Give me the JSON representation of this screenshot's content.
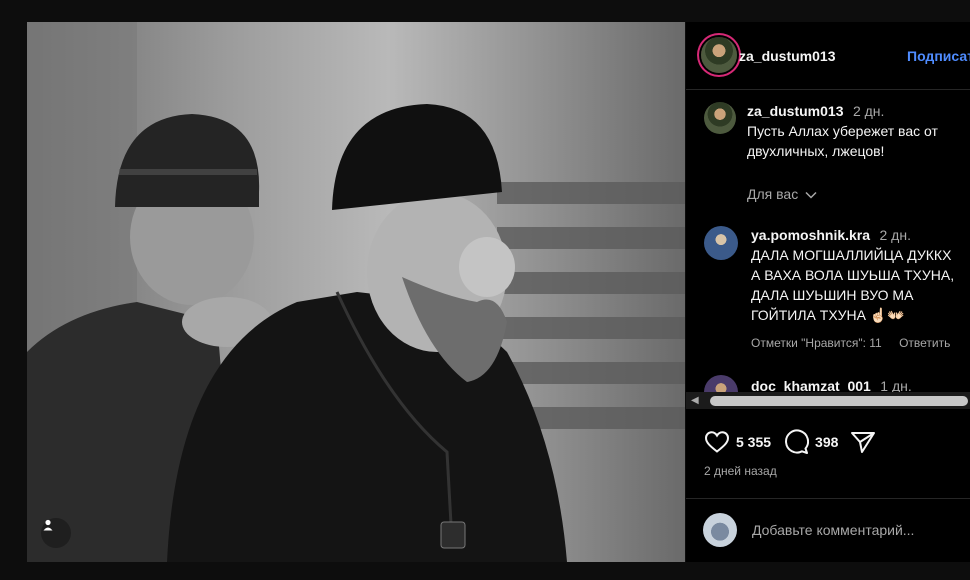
{
  "post": {
    "author": "za_dustum013",
    "follow_label": "Подписаться",
    "likes": "5 355",
    "comments_count": "398",
    "posted_ago": "2 дней назад",
    "add_comment_placeholder": "Добавьте комментарий..."
  },
  "caption": {
    "username": "za_dustum013",
    "time": "2 дн.",
    "text_line1": "Пусть Аллах убережет вас от",
    "text_line2": "двухличных, лжецов!"
  },
  "for_you_label": "Для вас",
  "comments": [
    {
      "username": "ya.pomoshnik.kra",
      "time": "2 дн.",
      "lines": [
        "ДАЛА МОГШАЛЛИЙЦА ДУККХ",
        "А ВАХА ВОЛА ШУЬША ТХУНА,",
        "ДАЛА ШУЬШИН ВУО МА",
        "ГОЙТИЛА ТХУНА ☝🏻👐🏻"
      ],
      "likes_label": "Отметки \"Нравится\": 11",
      "reply_label": "Ответить"
    },
    {
      "username": "doc_khamzat_001",
      "time": "1 дн."
    }
  ],
  "icons": [
    "heart-icon",
    "comment-icon",
    "share-icon",
    "user-tag-icon",
    "chevron-down-icon"
  ],
  "colors": {
    "accent": "#4f8cff",
    "background": "#000000",
    "muted": "#a8a8a8"
  }
}
